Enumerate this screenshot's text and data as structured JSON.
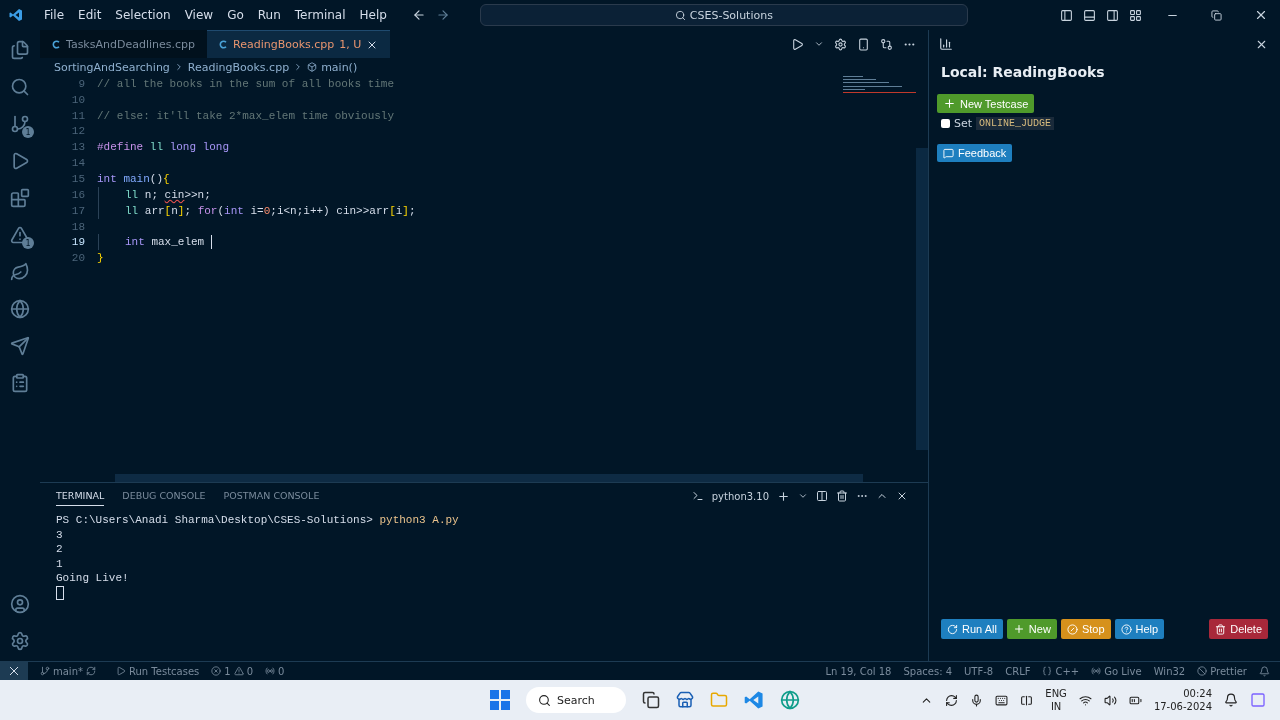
{
  "menu": [
    "File",
    "Edit",
    "Selection",
    "View",
    "Go",
    "Run",
    "Terminal",
    "Help"
  ],
  "command_center": "CSES-Solutions",
  "activity_badges": {
    "source_control": "1",
    "warnings": "1"
  },
  "tabs": [
    {
      "label": "TasksAndDeadlines.cpp",
      "selected": false
    },
    {
      "label": "ReadingBooks.cpp",
      "status": "1, U",
      "selected": true
    }
  ],
  "breadcrumbs": [
    "SortingAndSearching",
    "ReadingBooks.cpp",
    "main()"
  ],
  "code": [
    {
      "number": "9",
      "current": false,
      "indent": false,
      "tokens": [
        {
          "kind": "comment",
          "text": "// all the books in the sum of all books time"
        }
      ]
    },
    {
      "number": "10",
      "current": false
    },
    {
      "number": "11",
      "current": false,
      "indent": false,
      "tokens": [
        {
          "kind": "comment",
          "text": "// else: it'll take 2*max_elem time obviously"
        }
      ]
    },
    {
      "number": "12",
      "current": false
    },
    {
      "number": "13",
      "current": false,
      "indent": false,
      "tokens": [
        {
          "kind": "macro",
          "text": "#define"
        },
        {
          "kind": "type",
          "text": " ll"
        },
        {
          "kind": "keyword",
          "text": " long long"
        }
      ]
    },
    {
      "number": "14",
      "current": false
    },
    {
      "number": "15",
      "current": false,
      "indent": false,
      "tokens": [
        {
          "kind": "keyword",
          "text": "int"
        },
        {
          "kind": "func",
          "text": " main"
        },
        {
          "kind": "plain",
          "text": "()"
        },
        {
          "kind": "brace",
          "text": "{"
        }
      ]
    },
    {
      "number": "16",
      "current": false,
      "indent": true,
      "tokens": [
        {
          "kind": "type",
          "text": "ll"
        },
        {
          "kind": "plain",
          "text": " n; "
        },
        {
          "kind": "error",
          "text": "cin"
        },
        {
          "kind": "plain",
          "text": ">>n;"
        }
      ]
    },
    {
      "number": "17",
      "current": false,
      "indent": true,
      "tokens": [
        {
          "kind": "type",
          "text": "ll"
        },
        {
          "kind": "plain",
          "text": " arr"
        },
        {
          "kind": "brace",
          "text": "["
        },
        {
          "kind": "plain",
          "text": "n"
        },
        {
          "kind": "brace",
          "text": "]"
        },
        {
          "kind": "plain",
          "text": "; "
        },
        {
          "kind": "control",
          "text": "for"
        },
        {
          "kind": "plain",
          "text": "("
        },
        {
          "kind": "keyword",
          "text": "int"
        },
        {
          "kind": "plain",
          "text": " i="
        },
        {
          "kind": "number",
          "text": "0"
        },
        {
          "kind": "plain",
          "text": ";i<n;i++) cin>>arr"
        },
        {
          "kind": "brace",
          "text": "["
        },
        {
          "kind": "plain",
          "text": "i"
        },
        {
          "kind": "brace",
          "text": "]"
        },
        {
          "kind": "plain",
          "text": ";"
        }
      ]
    },
    {
      "number": "18",
      "current": false
    },
    {
      "number": "19",
      "current": true,
      "indent": true,
      "tokens": [
        {
          "kind": "keyword",
          "text": "int"
        },
        {
          "kind": "plain",
          "text": " max_elem "
        }
      ]
    },
    {
      "number": "20",
      "current": false,
      "indent": false,
      "tokens": [
        {
          "kind": "brace",
          "text": "}"
        }
      ]
    }
  ],
  "panel": {
    "tabs": [
      {
        "label": "TERMINAL",
        "selected": true
      },
      {
        "label": "DEBUG CONSOLE",
        "selected": false
      },
      {
        "label": "POSTMAN CONSOLE",
        "selected": false
      }
    ],
    "shell": "python3.10",
    "prompt": "PS C:\\Users\\Anadi Sharma\\Desktop\\CSES-Solutions>",
    "command": "python3 A.py",
    "output": [
      "3",
      "2",
      "1",
      "Going Live!"
    ]
  },
  "cph": {
    "title": "Local: ReadingBooks",
    "new_testcase": "New Testcase",
    "set_label": "Set",
    "online_judge": {
      "label": "ONLINE_JUDGE",
      "checked": false
    },
    "feedback": "Feedback",
    "actions": [
      {
        "kind": "run",
        "label": "Run All"
      },
      {
        "kind": "new",
        "label": "New"
      },
      {
        "kind": "stop",
        "label": "Stop"
      },
      {
        "kind": "help",
        "label": "Help"
      }
    ],
    "delete": "Delete"
  },
  "status_bar": {
    "branch": "main*",
    "run": "Run Testcases",
    "errors": "1",
    "warnings": "0",
    "ports": "0",
    "position": "Ln 19, Col 18",
    "spaces": "Spaces: 4",
    "encoding": "UTF-8",
    "eol": "CRLF",
    "language": "C++",
    "live": "Go Live",
    "platform": "Win32",
    "prettier": "Prettier"
  },
  "taskbar": {
    "search": "Search",
    "lang": "ENG",
    "region": "IN",
    "time": "00:24",
    "date": "17-06-2024"
  }
}
